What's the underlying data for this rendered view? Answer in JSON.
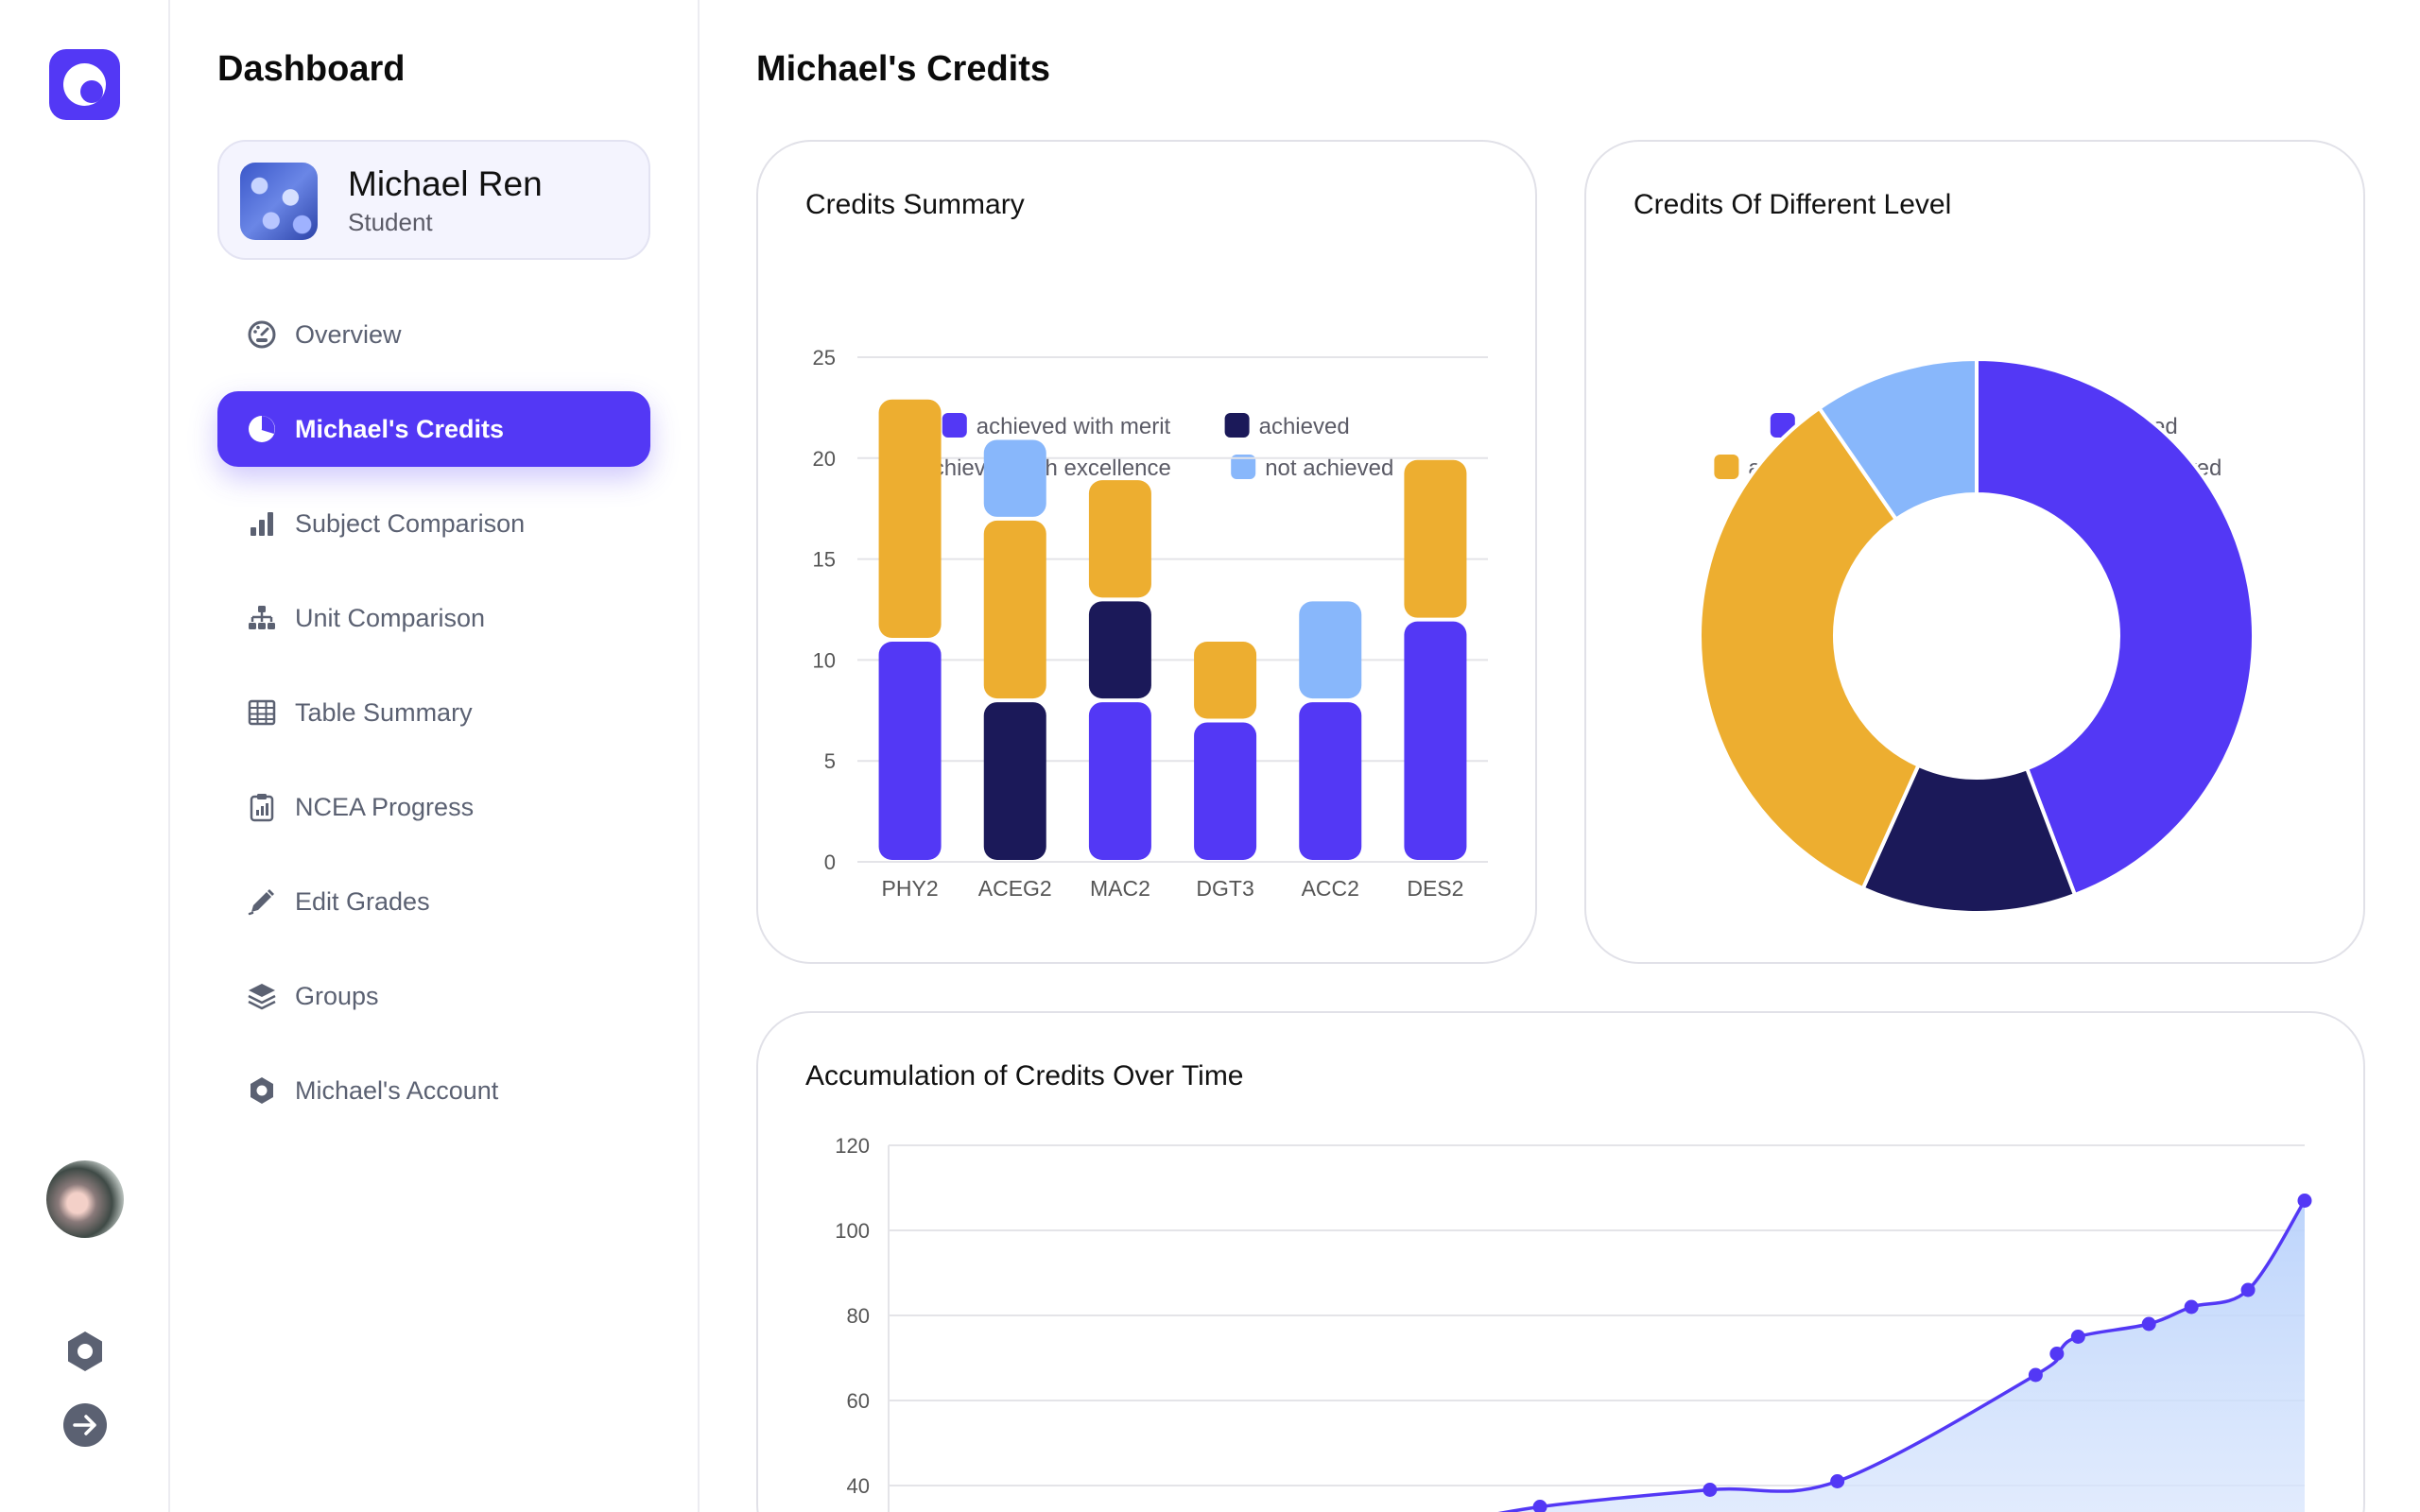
{
  "sidebar": {
    "title": "Dashboard",
    "profile": {
      "name": "Michael Ren",
      "role": "Student"
    },
    "items": [
      {
        "label": "Overview",
        "icon": "gauge-icon",
        "active": false
      },
      {
        "label": "Michael's Credits",
        "icon": "pie-chart-icon",
        "active": true
      },
      {
        "label": "Subject Comparison",
        "icon": "bar-chart-icon",
        "active": false
      },
      {
        "label": "Unit Comparison",
        "icon": "hierarchy-icon",
        "active": false
      },
      {
        "label": "Table Summary",
        "icon": "table-icon",
        "active": false
      },
      {
        "label": "NCEA Progress",
        "icon": "clipboard-chart-icon",
        "active": false
      },
      {
        "label": "Edit Grades",
        "icon": "pencil-icon",
        "active": false
      },
      {
        "label": "Groups",
        "icon": "layers-icon",
        "active": false
      },
      {
        "label": "Michael's Account",
        "icon": "hexagon-settings-icon",
        "active": false
      }
    ]
  },
  "main": {
    "title": "Michael's Credits"
  },
  "colors": {
    "merit": "#5338f5",
    "achieved": "#1b1959",
    "excellence": "#edae30",
    "not_achieved": "#88b7fb",
    "accent": "#5338f5"
  },
  "chart_data": [
    {
      "type": "bar",
      "title": "Credits Summary",
      "stacked": true,
      "categories": [
        "PHY2",
        "ACEG2",
        "MAC2",
        "DGT3",
        "ACC2",
        "DES2"
      ],
      "series": [
        {
          "name": "achieved with merit",
          "values": [
            11,
            0,
            8,
            7,
            8,
            12
          ]
        },
        {
          "name": "achieved",
          "values": [
            0,
            8,
            5,
            0,
            0,
            0
          ]
        },
        {
          "name": "achieved with excellence",
          "values": [
            12,
            9,
            6,
            4,
            0,
            8
          ]
        },
        {
          "name": "not achieved",
          "values": [
            0,
            4,
            0,
            0,
            5,
            0
          ]
        }
      ],
      "ylim": [
        0,
        25
      ],
      "yticks": [
        0,
        5,
        10,
        15,
        20,
        25
      ],
      "grid": true,
      "legend": "top-center"
    },
    {
      "type": "pie",
      "title": "Credits Of Different Level",
      "donut": true,
      "labels": [
        "achieved with merit",
        "achieved",
        "achieved with excellence",
        "not achieved"
      ],
      "values": [
        46,
        13,
        35,
        10
      ],
      "legend": "top-center"
    },
    {
      "type": "area",
      "title": "Accumulation of Credits Over Time",
      "x": [
        0.46,
        0.58,
        0.67,
        0.81,
        0.825,
        0.84,
        0.89,
        0.92,
        0.96,
        1.0
      ],
      "y": [
        35,
        39,
        41,
        66,
        71,
        75,
        78,
        82,
        86,
        107
      ],
      "ylim": [
        40,
        120
      ],
      "yticks": [
        40,
        60,
        80,
        100,
        120
      ],
      "grid": true
    }
  ]
}
